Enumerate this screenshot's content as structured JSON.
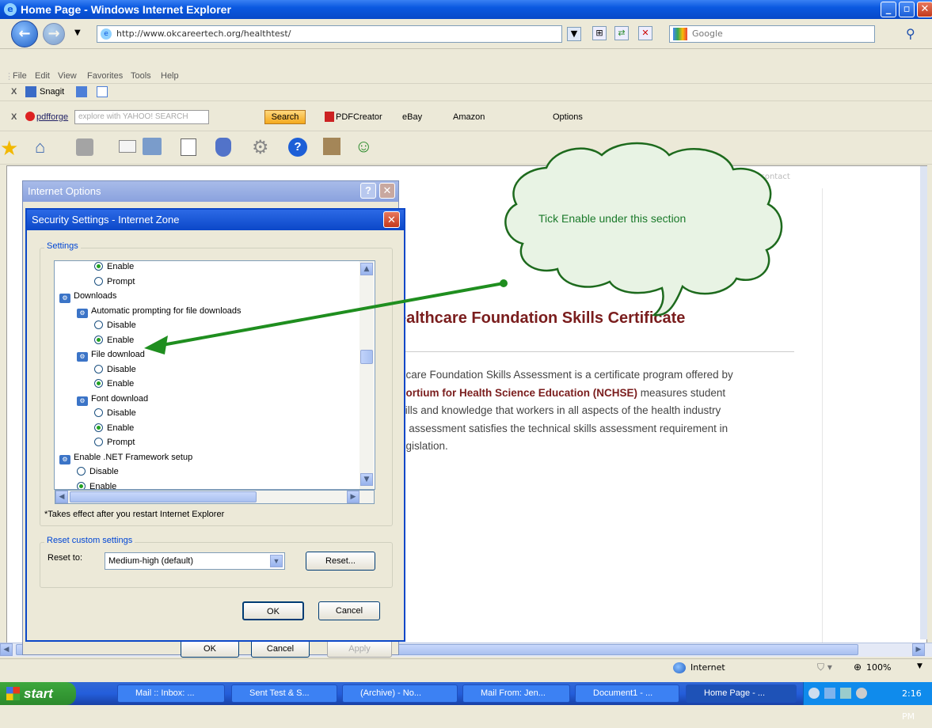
{
  "window": {
    "title": "Home Page - Windows Internet Explorer"
  },
  "nav": {
    "address": "http://www.okcareertech.org/healthtest/",
    "search_placeholder": "Google"
  },
  "menubar": [
    "File",
    "Edit",
    "View",
    "Favorites",
    "Tools",
    "Help"
  ],
  "toolbar1": {
    "snagit": "Snagit"
  },
  "toolbar2": {
    "pdfforge": "pdfforge",
    "yahoo_placeholder": "explore with YAHOO! SEARCH",
    "search_btn": "Search",
    "pdfcreator": "PDFCreator",
    "ebay": "eBay",
    "amazon": "Amazon",
    "options": "Options"
  },
  "web": {
    "nav_links": "ility  contact",
    "title": "ealthcare Foundation Skills Certificate",
    "para": [
      "hcare Foundation Skills Assessment is a certificate program offered by",
      "sortium for Health Science Education (NCHSE)",
      " measures student",
      "kills and knowledge that workers in all aspects of the health industry",
      "e assessment satisfies the technical skills assessment requirement in",
      "egislation."
    ]
  },
  "callout": {
    "text": "Tick Enable under this section"
  },
  "internet_options": {
    "title": "Internet Options",
    "ok": "OK",
    "cancel": "Cancel",
    "apply": "Apply"
  },
  "security": {
    "title": "Security Settings - Internet Zone",
    "settings_legend": "Settings",
    "items": [
      {
        "type": "radio",
        "label": "Enable",
        "checked": true,
        "level": 2
      },
      {
        "type": "radio",
        "label": "Prompt",
        "checked": false,
        "level": 2
      },
      {
        "type": "node",
        "label": "Downloads",
        "level": 0
      },
      {
        "type": "node",
        "label": "Automatic prompting for file downloads",
        "level": 1
      },
      {
        "type": "radio",
        "label": "Disable",
        "checked": false,
        "level": 2
      },
      {
        "type": "radio",
        "label": "Enable",
        "checked": true,
        "level": 2
      },
      {
        "type": "node",
        "label": "File download",
        "level": 1
      },
      {
        "type": "radio",
        "label": "Disable",
        "checked": false,
        "level": 2
      },
      {
        "type": "radio",
        "label": "Enable",
        "checked": true,
        "level": 2
      },
      {
        "type": "node",
        "label": "Font download",
        "level": 1
      },
      {
        "type": "radio",
        "label": "Disable",
        "checked": false,
        "level": 2
      },
      {
        "type": "radio",
        "label": "Enable",
        "checked": true,
        "level": 2
      },
      {
        "type": "radio",
        "label": "Prompt",
        "checked": false,
        "level": 2
      },
      {
        "type": "node",
        "label": "Enable .NET Framework setup",
        "level": 0
      },
      {
        "type": "radio",
        "label": "Disable",
        "checked": false,
        "level": 1
      },
      {
        "type": "radio",
        "label": "Enable",
        "checked": true,
        "level": 1
      }
    ],
    "note": "*Takes effect after you restart Internet Explorer",
    "reset_legend": "Reset custom settings",
    "reset_label": "Reset to:",
    "reset_value": "Medium-high (default)",
    "reset_btn": "Reset...",
    "ok": "OK",
    "cancel": "Cancel"
  },
  "status": {
    "zone": "Internet",
    "zoom": "100%"
  },
  "taskbar": {
    "start": "start",
    "tasks": [
      "Mail :: Inbox: ...",
      "Sent Test & S...",
      "(Archive) - No...",
      "Mail From: Jen...",
      "Document1 - ...",
      "Home Page - ..."
    ],
    "clock": "2:16 PM"
  }
}
